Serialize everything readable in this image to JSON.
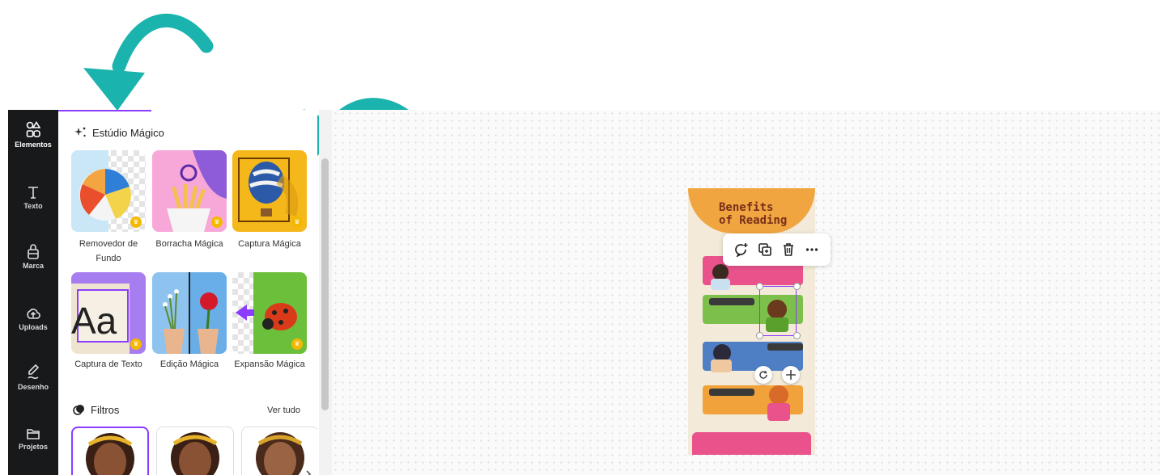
{
  "colors": {
    "rail_bg": "#18191b",
    "accent": "#8b3dff",
    "arrow": "#1bb3ad",
    "canvas_bg": "#fafafa"
  },
  "sidebar": {
    "items": [
      {
        "label": "Elementos",
        "icon": "elements-icon",
        "active": true
      },
      {
        "label": "Texto",
        "icon": "text-icon"
      },
      {
        "label": "Marca",
        "icon": "brand-icon"
      },
      {
        "label": "Uploads",
        "icon": "upload-icon"
      },
      {
        "label": "Desenho",
        "icon": "draw-icon"
      },
      {
        "label": "Projetos",
        "icon": "folder-icon"
      }
    ]
  },
  "panel": {
    "magic_studio_title": "Estúdio Mágico",
    "tools": [
      {
        "label": "Removedor de Fundo",
        "icon": "beach-ball-image",
        "pro": true
      },
      {
        "label": "Borracha Mágica",
        "icon": "fries-image",
        "pro": true
      },
      {
        "label": "Captura Mágica",
        "icon": "balloon-image",
        "pro": true
      },
      {
        "label": "Captura de Texto",
        "icon": "text-aa-image",
        "pro": true
      },
      {
        "label": "Edição Mágica",
        "icon": "flowers-image"
      },
      {
        "label": "Expansão Mágica",
        "icon": "ladybug-image",
        "pro": true
      }
    ],
    "filters_title": "Filtros",
    "see_all": "Ver tudo",
    "filters": [
      {
        "icon": "portrait-thumb",
        "selected": true
      },
      {
        "icon": "portrait-thumb"
      },
      {
        "icon": "portrait-thumb"
      }
    ]
  },
  "canvas": {
    "design_title_line1": "Benefits",
    "design_title_line2": "of Reading",
    "toolbar_icons": [
      "comment-add-icon",
      "duplicate-icon",
      "trash-icon",
      "more-icon"
    ]
  }
}
